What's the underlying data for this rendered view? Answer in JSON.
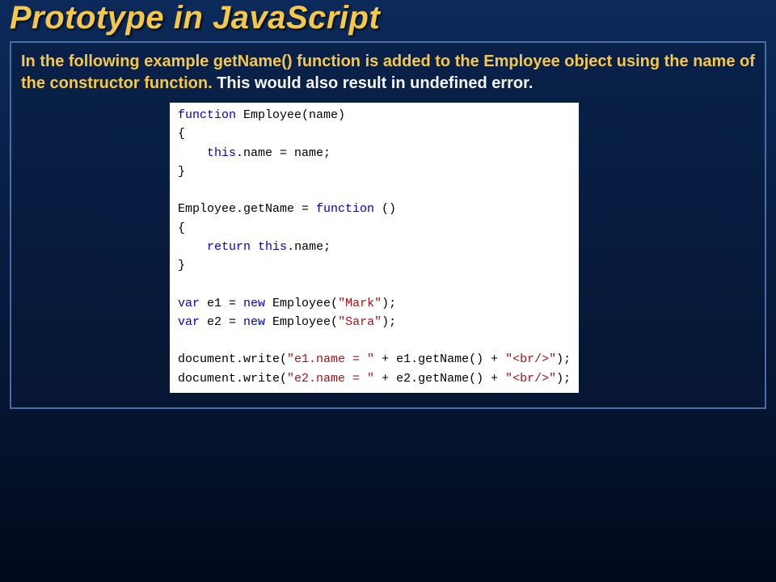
{
  "title": "Prototype in JavaScript",
  "desc": {
    "highlight": "In the following example getName() function is added to the Employee object using the name of the constructor function. ",
    "rest": "This would also result in undefined error."
  },
  "code": {
    "l1": {
      "kw": "function",
      "rest": " Employee(name)"
    },
    "l2": "{",
    "l3": {
      "indent": "    ",
      "kw": "this",
      "rest": ".name = name;"
    },
    "l4": "}",
    "l5": "",
    "l6": {
      "pre": "Employee.getName = ",
      "kw": "function",
      "post": " ()"
    },
    "l7": "{",
    "l8": {
      "indent": "    ",
      "kw1": "return",
      "sp": " ",
      "kw2": "this",
      "rest": ".name;"
    },
    "l9": "}",
    "l10": "",
    "l11": {
      "kw1": "var",
      "mid": " e1 = ",
      "kw2": "new",
      "post": " Employee(",
      "str": "\"Mark\"",
      "end": ");"
    },
    "l12": {
      "kw1": "var",
      "mid": " e2 = ",
      "kw2": "new",
      "post": " Employee(",
      "str": "\"Sara\"",
      "end": ");"
    },
    "l13": "",
    "l14": {
      "pre": "document.write(",
      "s1": "\"e1.name = \"",
      "mid1": " + e1.getName() + ",
      "s2": "\"<br/>\"",
      "end": ");"
    },
    "l15": {
      "pre": "document.write(",
      "s1": "\"e2.name = \"",
      "mid1": " + e2.getName() + ",
      "s2": "\"<br/>\"",
      "end": ");"
    }
  }
}
